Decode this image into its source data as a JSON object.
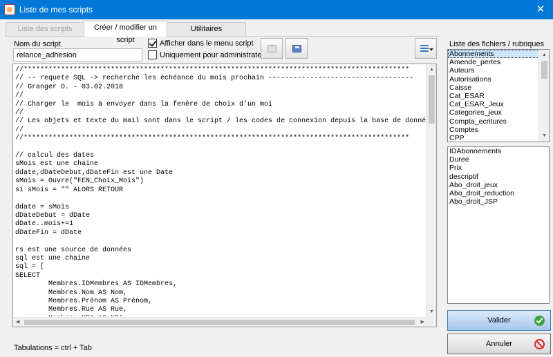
{
  "window": {
    "title": "Liste de mes scripts"
  },
  "tabs": [
    {
      "label": "Liste des scripts"
    },
    {
      "label": "Créer / modifier un script"
    },
    {
      "label": "Utilitaires"
    }
  ],
  "form": {
    "name_label": "Nom du script",
    "name_value": "relance_adhesion",
    "show_in_menu_label": "Afficher dans le menu script",
    "show_in_menu_checked": true,
    "admin_only_label": "Uniquement pour administrateur",
    "admin_only_checked": false
  },
  "editor": {
    "code": "//*********************************************************************************************\n// -- requete SQL -> recherche les échéance du mois prochain -----------------------------------\n// Granger O. - 03.02.2018\n//\n// Charger le  mois à envoyer dans la fenêre de choix d'un moi\n//\n// Les objets et texte du mail sont dans le script / les codes de connexion depuis la base de donnée\n//\n//*********************************************************************************************\n\n// calcul des dates\nsMois est une chaine\nddate,dDateDebut,dDateFin est une Date\nsMois = Ouvre(\"FEN_Choix_Mois\")\nsi sMois = \"\" ALORS RETOUR\n\nddate = sMois\ndDateDebut = dDate\ndDate..mois+=1\ndDateFin = dDate\n\nrs est une source de données\nsql est une chaine\nsql = [\nSELECT\n        Membres.IDMembres AS IDMembres,\n        Membres.Nom AS Nom,\n        Membres.Prénom AS Prénom,\n        Membres.Rue AS Rue,\n        Membres.NPA AS NPA,\n        Membres.Localite AS Localite,",
    "hint": "Tabulations = ctrl + Tab"
  },
  "files_panel": {
    "label": "Liste des fichiers / rubriques",
    "tables": [
      "Abonnements",
      "Amende_pertes",
      "Auteurs",
      "Autorisations",
      "Caisse",
      "Cat_ESAR",
      "Cat_ESAR_Jeux",
      "Categories_jeux",
      "Compta_ecritures",
      "Comptes",
      "CPP"
    ],
    "selected_table": "Abonnements",
    "fields": [
      "IDAbonnements",
      "Duree",
      "Prix",
      "descriptif",
      "Abo_droit_jeux",
      "Abo_droit_reduction",
      "Abo_droit_JSP"
    ]
  },
  "buttons": {
    "validate": "Valider",
    "cancel": "Annuler"
  },
  "colors": {
    "titlebar": "#0078d7",
    "selection": "#cce8ff",
    "validate_icon": "#3da23d",
    "cancel_icon": "#dd2222"
  },
  "icons": {
    "app": "app-icon",
    "copy": "copy-icon",
    "save": "save-icon",
    "menu": "menu-lines-icon",
    "ok": "check-circle-icon",
    "cancel": "no-entry-icon"
  }
}
